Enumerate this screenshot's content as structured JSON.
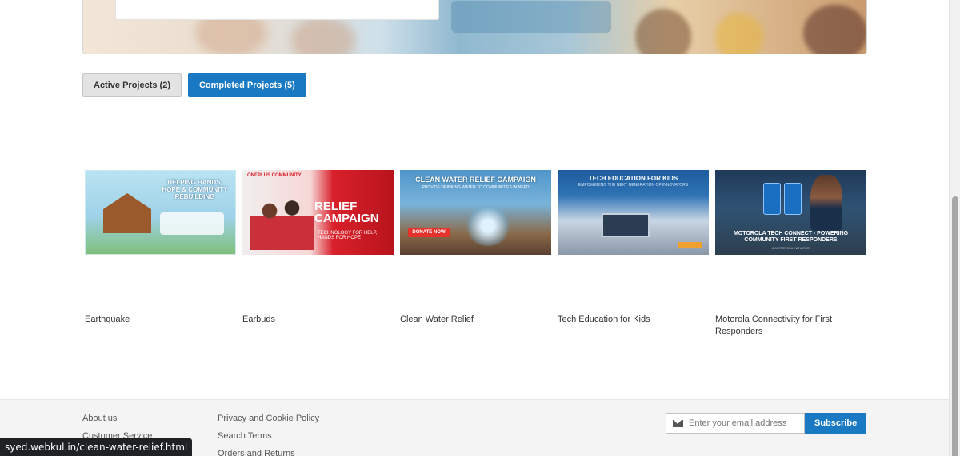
{
  "tabs": [
    {
      "label": "Active Projects (2)",
      "active": false
    },
    {
      "label": "Completed Projects (5)",
      "active": true
    }
  ],
  "projects": [
    {
      "name": "Earthquake",
      "image_text": "HELPING HANDS, HOPE & COMMUNITY REBUILDING"
    },
    {
      "name": "Earbuds",
      "image_brand": "ONEPLUS COMMUNITY",
      "image_text": "RELIEF CAMPAIGN",
      "image_sub": "TECHNOLOGY FOR HELP, HANDS FOR HOPE"
    },
    {
      "name": "Clean Water Relief",
      "image_text": "CLEAN WATER RELIEF CAMPAIGN",
      "image_sub": "PROVIDE DRINKING WATER TO COMMUNITIES IN NEED",
      "image_button": "DONATE NOW"
    },
    {
      "name": "Tech Education for Kids",
      "image_text": "TECH EDUCATION FOR KIDS",
      "image_sub": "EMPOWERING THE NEXT GENERATION OF INNOVATORS"
    },
    {
      "name": "Motorola Connectivity for First Responders",
      "image_text": "MOTOROLA TECH CONNECT - POWERING COMMUNITY FIRST RESPONDERS",
      "image_sub": "A MOTOROLA INITIATIVE"
    }
  ],
  "footer": {
    "col1": [
      "About us",
      "Customer Service"
    ],
    "col2": [
      "Privacy and Cookie Policy",
      "Search Terms",
      "Orders and Returns"
    ],
    "newsletter": {
      "placeholder": "Enter your email address",
      "button": "Subscribe"
    }
  },
  "status_url": "syed.webkul.in/clean-water-relief.html",
  "colors": {
    "primary": "#1979c3",
    "tab_inactive_bg": "#e3e3e3",
    "footer_bg": "#f4f4f4"
  }
}
